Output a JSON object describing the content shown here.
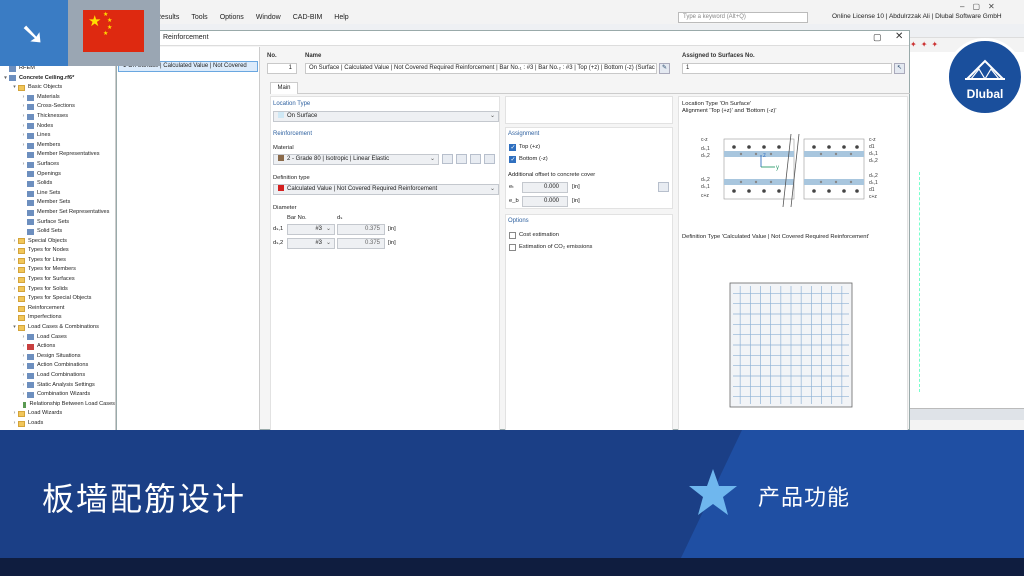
{
  "menubar": {
    "items": [
      "Results",
      "Tools",
      "Options",
      "Window",
      "CAD-BIM",
      "Help"
    ],
    "search_placeholder": "Type a keyword (Alt+Q)",
    "license": "Online License 10 | Abdulrzzak Ali | Dlubal Software GmbH"
  },
  "navigator": {
    "items": [
      {
        "label": "RFEM",
        "level": 0,
        "icon": "app",
        "twisty": ""
      },
      {
        "label": "Concrete Ceiling.rf6*",
        "level": 0,
        "icon": "file",
        "twisty": "▾",
        "bold": true
      },
      {
        "label": "Basic Objects",
        "level": 1,
        "icon": "folder",
        "twisty": "▾"
      },
      {
        "label": "Materials",
        "level": 2,
        "icon": "obj",
        "twisty": "›"
      },
      {
        "label": "Cross-Sections",
        "level": 2,
        "icon": "obj",
        "twisty": "›"
      },
      {
        "label": "Thicknesses",
        "level": 2,
        "icon": "obj",
        "twisty": "›"
      },
      {
        "label": "Nodes",
        "level": 2,
        "icon": "obj",
        "twisty": "›"
      },
      {
        "label": "Lines",
        "level": 2,
        "icon": "obj",
        "twisty": "›"
      },
      {
        "label": "Members",
        "level": 2,
        "icon": "obj",
        "twisty": "›"
      },
      {
        "label": "Member Representatives",
        "level": 2,
        "icon": "obj",
        "twisty": ""
      },
      {
        "label": "Surfaces",
        "level": 2,
        "icon": "obj",
        "twisty": "›"
      },
      {
        "label": "Openings",
        "level": 2,
        "icon": "obj",
        "twisty": ""
      },
      {
        "label": "Solids",
        "level": 2,
        "icon": "obj",
        "twisty": ""
      },
      {
        "label": "Line Sets",
        "level": 2,
        "icon": "obj",
        "twisty": ""
      },
      {
        "label": "Member Sets",
        "level": 2,
        "icon": "obj",
        "twisty": ""
      },
      {
        "label": "Member Set Representatives",
        "level": 2,
        "icon": "obj",
        "twisty": ""
      },
      {
        "label": "Surface Sets",
        "level": 2,
        "icon": "obj",
        "twisty": ""
      },
      {
        "label": "Solid Sets",
        "level": 2,
        "icon": "obj",
        "twisty": ""
      },
      {
        "label": "Special Objects",
        "level": 1,
        "icon": "folder",
        "twisty": "›"
      },
      {
        "label": "Types for Nodes",
        "level": 1,
        "icon": "folder",
        "twisty": "›"
      },
      {
        "label": "Types for Lines",
        "level": 1,
        "icon": "folder",
        "twisty": "›"
      },
      {
        "label": "Types for Members",
        "level": 1,
        "icon": "folder",
        "twisty": "›"
      },
      {
        "label": "Types for Surfaces",
        "level": 1,
        "icon": "folder",
        "twisty": "›"
      },
      {
        "label": "Types for Solids",
        "level": 1,
        "icon": "folder",
        "twisty": "›"
      },
      {
        "label": "Types for Special Objects",
        "level": 1,
        "icon": "folder",
        "twisty": "›"
      },
      {
        "label": "Reinforcement",
        "level": 1,
        "icon": "folder",
        "twisty": ""
      },
      {
        "label": "Imperfections",
        "level": 1,
        "icon": "folder",
        "twisty": ""
      },
      {
        "label": "Load Cases & Combinations",
        "level": 1,
        "icon": "folder",
        "twisty": "▾"
      },
      {
        "label": "Load Cases",
        "level": 2,
        "icon": "obj",
        "twisty": "›"
      },
      {
        "label": "Actions",
        "level": 2,
        "icon": "red",
        "twisty": "›"
      },
      {
        "label": "Design Situations",
        "level": 2,
        "icon": "obj",
        "twisty": "›"
      },
      {
        "label": "Action Combinations",
        "level": 2,
        "icon": "obj",
        "twisty": "›"
      },
      {
        "label": "Load Combinations",
        "level": 2,
        "icon": "obj",
        "twisty": "›"
      },
      {
        "label": "Static Analysis Settings",
        "level": 2,
        "icon": "obj",
        "twisty": "›"
      },
      {
        "label": "Combination Wizards",
        "level": 2,
        "icon": "obj",
        "twisty": "›"
      },
      {
        "label": "Relationship Between Load Cases",
        "level": 2,
        "icon": "green",
        "twisty": ""
      },
      {
        "label": "Load Wizards",
        "level": 1,
        "icon": "folder",
        "twisty": "›"
      },
      {
        "label": "Loads",
        "level": 1,
        "icon": "folder",
        "twisty": "›"
      }
    ]
  },
  "dialog": {
    "title": "Reinforcement",
    "list_item": "1  On Surface | Calculated Value | Not Covered",
    "no_label": "No.",
    "no_value": "1",
    "name_label": "Name",
    "name_value": "On Surface | Calculated Value | Not Covered Required Reinforcement | Bar No.₁ : #3 | Bar No.₂ : #3 | Top (+z) | Bottom (-z) (Surfac",
    "assigned_label": "Assigned to Surfaces No.",
    "assigned_value": "1",
    "tab_main": "Main",
    "location_type_title": "Location Type",
    "location_type_value": "On Surface",
    "reinforcement_title": "Reinforcement",
    "material_label": "Material",
    "material_value": "2 - Grade 80 | Isotropic | Linear Elastic",
    "definition_type_label": "Definition type",
    "definition_type_value": "Calculated Value | Not Covered Required Reinforcement",
    "diameter_label": "Diameter",
    "bar_no_header": "Bar No.",
    "ds_header": "dₛ",
    "rows": [
      {
        "label": "dₛ,1",
        "bar": "#3",
        "value": "0.375",
        "unit": "[in]"
      },
      {
        "label": "dₛ,2",
        "bar": "#3",
        "value": "0.375",
        "unit": "[in]"
      }
    ],
    "assignment_title": "Assignment",
    "top_label": "Top (+z)",
    "bottom_label": "Bottom (-z)",
    "offset_title": "Additional offset to concrete cover",
    "offsets": [
      {
        "label": "eₜ",
        "value": "0.000",
        "unit": "[in]"
      },
      {
        "label": "e_b",
        "value": "0.000",
        "unit": "[in]"
      }
    ],
    "options_title": "Options",
    "cost_label": "Cost estimation",
    "co2_label": "Estimation of CO₂ emissions",
    "preview1_line1": "Location Type 'On Surface'",
    "preview1_line2": "Alignment 'Top (+z)' and 'Bottom (-z)'",
    "preview2_title": "Definition Type 'Calculated Value | Not Covered Required Reinforcement'",
    "section_labels_left": [
      "c-z",
      "dₛ,1",
      "dₛ,2",
      "dₛ,2",
      "dₛ,1",
      "c+z"
    ],
    "section_labels_right": [
      "c-z",
      "d1",
      "dₛ,1",
      "dₛ,2",
      "dₛ,2",
      "dₛ,1",
      "d1",
      "c+z"
    ],
    "axis_z": "z",
    "axis_y": "y"
  },
  "overlay": {
    "logo_text": "Dlubal",
    "title": "板墙配筋设计",
    "subtitle": "产品功能"
  },
  "colors": {
    "accent": "#2f6fbf",
    "banner": "#1b3f86",
    "banner_wedge": "#1f4fa3",
    "flag_red": "#de2910",
    "flag_yellow": "#ffde00",
    "material_swatch": "#8a6a4a",
    "definition_swatch": "#d42020"
  }
}
